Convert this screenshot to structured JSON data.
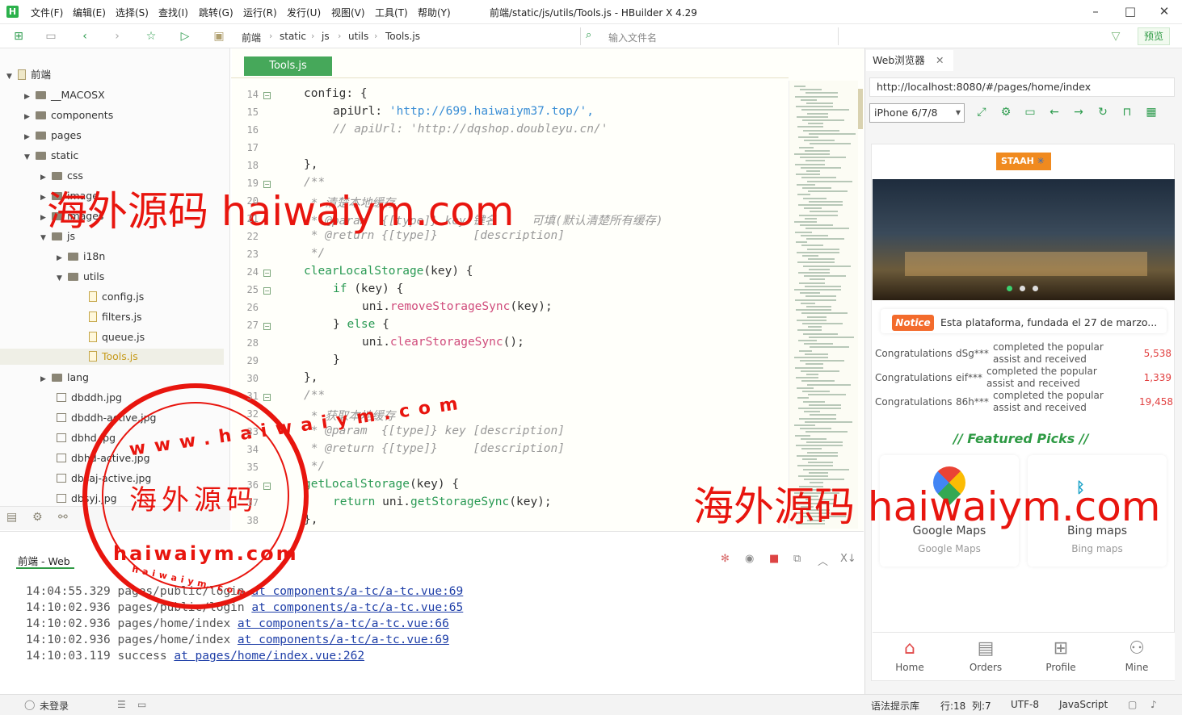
{
  "app": {
    "title": "前端/static/js/utils/Tools.js - HBuilder X 4.29",
    "logo": "H"
  },
  "menu": [
    "文件(F)",
    "编辑(E)",
    "选择(S)",
    "查找(I)",
    "跳转(G)",
    "运行(R)",
    "发行(U)",
    "视图(V)",
    "工具(T)",
    "帮助(Y)"
  ],
  "breadcrumb": [
    "前端",
    "static",
    "js",
    "utils",
    "Tools.js"
  ],
  "file_search_placeholder": "输入文件名",
  "preview_label": "预览",
  "tree": [
    {
      "label": "前端",
      "type": "project"
    },
    {
      "label": "__MACOSX",
      "type": "folder"
    },
    {
      "label": "components",
      "type": "folder"
    },
    {
      "label": "pages",
      "type": "folder"
    },
    {
      "label": "static",
      "type": "folder"
    },
    {
      "label": "css",
      "type": "folder"
    },
    {
      "label": "image",
      "type": "folder"
    },
    {
      "label": "images",
      "type": "folder"
    },
    {
      "label": "js",
      "type": "folder"
    },
    {
      "label": "i18n",
      "type": "folder"
    },
    {
      "label": "utils",
      "type": "folder"
    },
    {
      "label": "config.js",
      "type": "file"
    },
    {
      "label": "filters.js",
      "type": "file"
    },
    {
      "label": "queue.js",
      "type": "file"
    },
    {
      "label": "Tools.js",
      "type": "file"
    },
    {
      "label": "lang",
      "type": "folder"
    },
    {
      "label": "dbddh.jpg",
      "type": "image"
    },
    {
      "label": "dbddh-active.jpg",
      "type": "image"
    },
    {
      "label": "dbhd.jpg",
      "type": "image"
    },
    {
      "label": "dbhd-active.jpg",
      "type": "image"
    },
    {
      "label": "dbsaj-active.jpg",
      "type": "image"
    },
    {
      "label": "dbsyj.jpg",
      "type": "image"
    }
  ],
  "editor": {
    "tab": "Tools.js",
    "line_numbers": [
      "14",
      "15",
      "16",
      "17",
      "18",
      "19",
      "20",
      "21",
      "22",
      "23",
      "24",
      "25",
      "26",
      "27",
      "28",
      "29",
      "30",
      "31",
      "32",
      "33",
      "34",
      "35",
      "36",
      "37",
      "38"
    ],
    "code": {
      "l14": "config: {",
      "l15a": "apiUrl: ",
      "l15b": "'http://699.haiwaiym37.top/',",
      "l16": "// apiUrl: 'http://dqshop.doubleyu.cn/'",
      "l18": "},",
      "l19": "/**",
      "l20": " * 清楚本地缓存",
      "l21": " * @param  {[type]} key 键名     可填(默认清楚所有缓存)",
      "l22": " * @return {[type]}     [description]",
      "l23": " */",
      "l24a": "clearLocalStorage",
      "l24b": "(key) {",
      "l25a": "if",
      "l25b": " (key) {",
      "l26a": "uni.",
      "l26b": "removeStorageSync",
      "l26c": "(key);",
      "l27a": "} ",
      "l27b": "else",
      "l27c": " {",
      "l28a": "uni.",
      "l28b": "clearStorageSync",
      "l28c": "();",
      "l29": "}",
      "l30": "},",
      "l31": "/**",
      "l32": " * 获取本地缓存",
      "l33": " * @param  {[type]} key [description]",
      "l34": " * @return {[type]}     [description]",
      "l35": " */",
      "l36a": "getLocalStorage",
      "l36b": "(key) {",
      "l37a": "return",
      "l37b": " uni.",
      "l37c": "getStorageSync",
      "l37d": "(key);",
      "l38": "},"
    }
  },
  "console": {
    "title": "前端 - Web",
    "logs": [
      {
        "time": "14:04:55.329",
        "msg": "pages/public/login",
        "link": "at components/a-tc/a-tc.vue:69"
      },
      {
        "time": "14:10:02.936",
        "msg": "pages/public/login",
        "link": "at components/a-tc/a-tc.vue:65"
      },
      {
        "time": "14:10:02.936",
        "msg": "pages/home/index",
        "link": "at components/a-tc/a-tc.vue:66"
      },
      {
        "time": "14:10:02.936",
        "msg": "pages/home/index",
        "link": "at components/a-tc/a-tc.vue:69"
      },
      {
        "time": "14:10:03.119",
        "msg": "success",
        "link": "at pages/home/index.vue:262"
      }
    ]
  },
  "browser": {
    "tab": "Web浏览器",
    "url": "http://localhost:8080/#/pages/home/index",
    "device": "iPhone 6/7/8"
  },
  "phone": {
    "logo": "STAAH",
    "notice_badge": "Notice",
    "notice_text": "Esta plataforma, fundada el 27 de marzo...",
    "rows": [
      {
        "label": "Congratulations",
        "user": "dSg***",
        "text": "completed the popular assist and received",
        "amount": "5,538"
      },
      {
        "label": "Congratulations",
        "user": "eif***",
        "text": "completed the popular assist and received",
        "amount": "1,339"
      },
      {
        "label": "Congratulations",
        "user": "86h***",
        "text": "completed the popular assist and received",
        "amount": "19,458"
      }
    ],
    "featured": "// Featured Picks //",
    "cards": [
      {
        "title": "Google Maps",
        "sub": "Google Maps"
      },
      {
        "title": "Bing maps",
        "sub": "Bing maps"
      }
    ],
    "tabs": [
      "Home",
      "Orders",
      "Profile",
      "Mine"
    ]
  },
  "status": {
    "login": "未登录",
    "lang_lib": "语法提示库",
    "position": "行:18  列:7",
    "encoding": "UTF-8",
    "language": "JavaScript"
  },
  "watermark": {
    "text1": "海外源码 haiwaiym.com",
    "stamp_cn": "海外源码",
    "stamp_en": "haiwaiym.com",
    "stamp_ring": "www.haiwaiym.com",
    "stamp_small": "haiwaiym.com"
  },
  "colors": {
    "accent": "#2e9a44",
    "watermark": "#e8150e",
    "notice": "#f36b2c"
  }
}
